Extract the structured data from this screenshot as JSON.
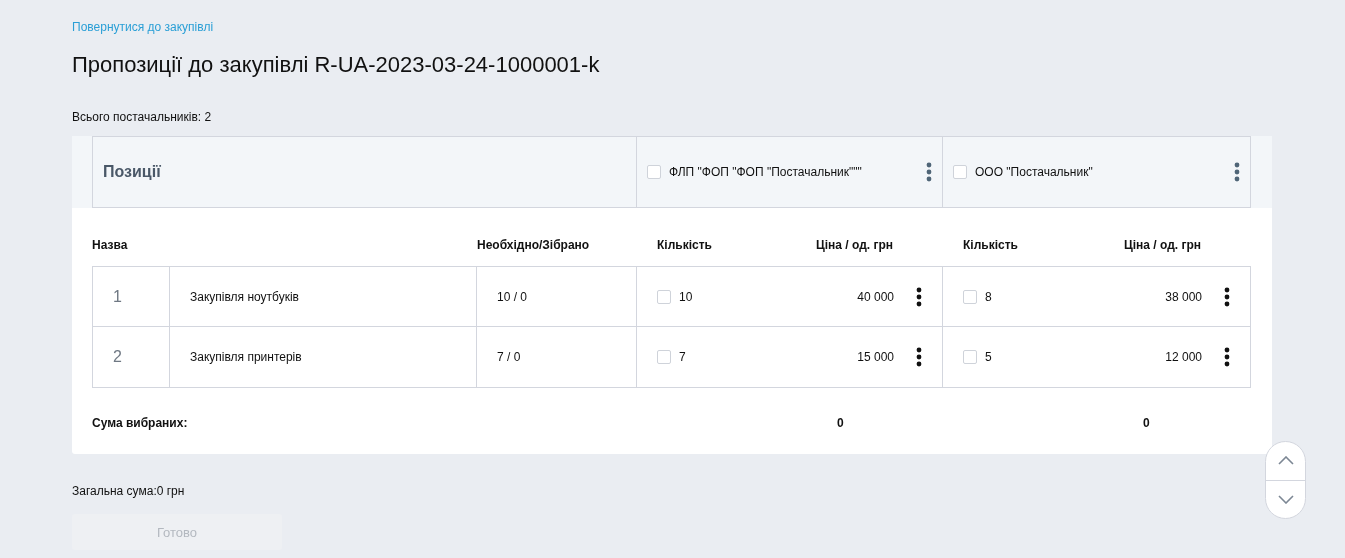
{
  "back_link": "Повернутися до закупівлі",
  "title": "Пропозиції до закупівлі R-UA-2023-03-24-1000001-k",
  "suppliers_total": "Всього постачальників: 2",
  "positions_header": "Позиції",
  "suppliers": [
    {
      "name": "ФЛП \"ФОП \"ФОП \"Постачальник\"\"\"",
      "checked": false
    },
    {
      "name": "ООО \"Постачальник\"",
      "checked": false
    }
  ],
  "columns": {
    "name": "Назва",
    "needed": "Необхідно/Зібрано",
    "supplier_columns": [
      {
        "quantity": "Кількість",
        "price": "Ціна / од. грн"
      },
      {
        "quantity": "Кількість",
        "price": "Ціна / од. грн"
      }
    ]
  },
  "rows": [
    {
      "number": "1",
      "name": "Закупівля ноутбуків",
      "needed": "10 / 0",
      "offers": [
        {
          "quantity": "10",
          "checked": false,
          "price": "40 000"
        },
        {
          "quantity": "8",
          "checked": false,
          "price": "38 000"
        }
      ]
    },
    {
      "number": "2",
      "name": "Закупівля принтерів",
      "needed": "7 / 0",
      "offers": [
        {
          "quantity": "7",
          "checked": false,
          "price": "15 000"
        },
        {
          "quantity": "5",
          "checked": false,
          "price": "12 000"
        }
      ]
    }
  ],
  "selected_sum": {
    "label": "Сума вибраних:",
    "values": [
      "0",
      "0"
    ]
  },
  "total": "Загальна сума:0 грн",
  "done_button": {
    "label": "Готово",
    "disabled": true
  }
}
